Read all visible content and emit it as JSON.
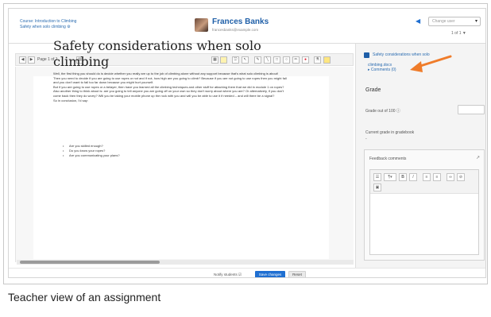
{
  "header": {
    "course_link": "Course: Introduction to Climbing",
    "assignment_link": "Safety when solo climbing ⚙",
    "user_name": "Frances Banks",
    "user_email": "francesbanks@example.com",
    "change_user_placeholder": "Change user",
    "user_count": "1 of 1 ▼"
  },
  "toolbar": {
    "page_label": "Page 1 of 1"
  },
  "document": {
    "title": "Safety considerations when solo climbing",
    "paragraphs": [
      "Well, the first thing you should do is decide whether you really are up to the job of climbing alone without any support because that's what solo climbing is about!",
      "Then you need to decide if you are going to use ropes or not and if not, how high are you going to climb? Because if you are not going to use ropes then you might fall and you don't want to fall too far down because you might hurt yourself.",
      "But if you are going to use ropes or a belayer, then have you learned all the climbing techniques and other stuff for attaching them that we did in module 1 on ropes?",
      "Also another thing to think about is: are you going to tell anyone you are going off on your own so they don't worry about where you are? Or alternatively, if you don't come back then they do worry? Will you be taking your mobile phone up the rock with you and will you be able to use it if needed – and will there be a signal?",
      "So in conclusion, I'd say:"
    ],
    "bullets": [
      "Are you skilled enough?",
      "Do you know your ropes?",
      "Are you communicating your plans?"
    ]
  },
  "panel": {
    "attachment_title": "Safety considerations when solo",
    "attachment_doc": "climbing.docx",
    "attachment_comments": "▸ Comments (0)",
    "grade_heading": "Grade",
    "grade_label": "Grade out of 100 ⓘ",
    "current_grade_label": "Current grade in gradebook",
    "current_grade_value": "-",
    "feedback_title": "Feedback comments",
    "expand_glyph": "↗"
  },
  "footer": {
    "notify_label": "Notify students ☑",
    "save_label": "Save changes",
    "reset_label": "Reset"
  },
  "caption": "Teacher view of an assignment",
  "colors": {
    "primary": "#1f6fd1",
    "arrow": "#ef7c2a"
  }
}
